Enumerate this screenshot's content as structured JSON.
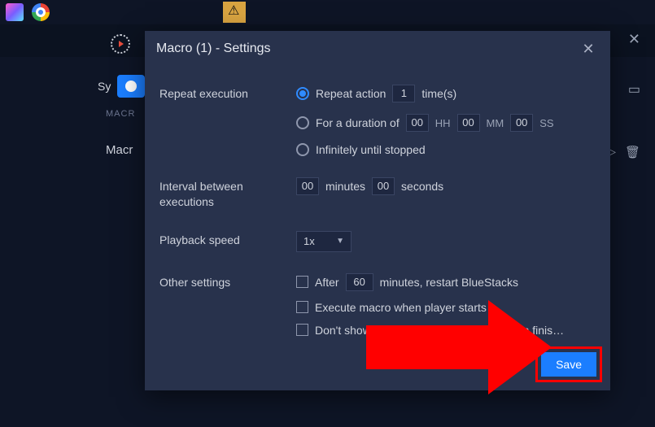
{
  "background": {
    "sy_label": "Sy",
    "macr_label": "MACR",
    "macro_label": "Macr"
  },
  "dialog": {
    "title": "Macro (1) - Settings",
    "repeat": {
      "label": "Repeat execution",
      "opt_action": {
        "prefix": "Repeat action",
        "value": "1",
        "suffix": "time(s)"
      },
      "opt_duration": {
        "prefix": "For a duration of",
        "hh": "00",
        "hh_label": "HH",
        "mm": "00",
        "mm_label": "MM",
        "ss": "00",
        "ss_label": "SS"
      },
      "opt_infinite": "Infinitely until stopped"
    },
    "interval": {
      "label": "Interval between executions",
      "minutes_value": "00",
      "minutes_label": "minutes",
      "seconds_value": "00",
      "seconds_label": "seconds"
    },
    "playback": {
      "label": "Playback speed",
      "value": "1x"
    },
    "other": {
      "label": "Other settings",
      "restart_prefix": "After",
      "restart_value": "60",
      "restart_suffix": "minutes, restart BlueStacks",
      "on_start": "Execute macro when player starts",
      "hide_window": "Don't show macro window when execution finis…"
    },
    "save_label": "Save"
  }
}
